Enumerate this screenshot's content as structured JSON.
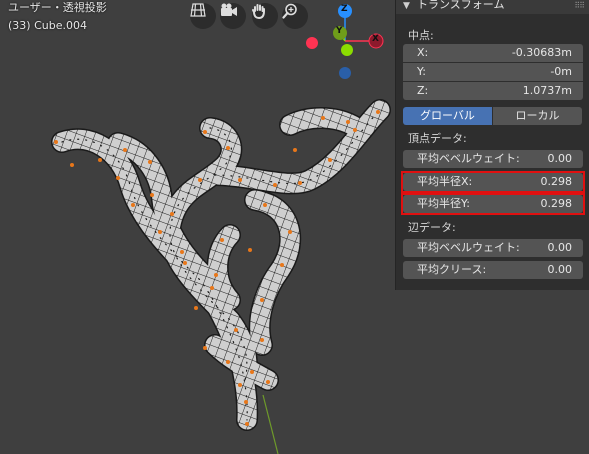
{
  "viewport": {
    "view_title": "ユーザー・透視投影",
    "object_label": "(33) Cube.004",
    "gizmo": {
      "z_label": "Z",
      "y_label": "Y",
      "x_label": "X"
    },
    "tool_icons": [
      "grid-view-icon",
      "camera-icon",
      "hand-pan-icon",
      "zoom-icon"
    ]
  },
  "panel": {
    "header_title": "トランスフォーム",
    "median_label": "中点:",
    "x_label": "X:",
    "x_value": "-0.30683m",
    "y_label": "Y:",
    "y_value": "-0m",
    "z_label": "Z:",
    "z_value": "1.0737m",
    "global_label": "グローバル",
    "local_label": "ローカル",
    "vertex_data_label": "頂点データ:",
    "vertex_bevel_label": "平均ベベルウェイト:",
    "vertex_bevel_value": "0.00",
    "radius_x_label": "平均半径X:",
    "radius_x_value": "0.298",
    "radius_y_label": "平均半径Y:",
    "radius_y_value": "0.298",
    "edge_data_label": "辺データ:",
    "edge_bevel_label": "平均ベベルウェイト:",
    "edge_bevel_value": "0.00",
    "edge_crease_label": "平均クリース:",
    "edge_crease_value": "0.00"
  },
  "colors": {
    "accent": "#4772b3",
    "highlight": "#e01010",
    "vertex": "#e8771a",
    "axis_x": "#ff3352",
    "axis_y": "#8bdc00",
    "axis_z": "#2890ff"
  }
}
